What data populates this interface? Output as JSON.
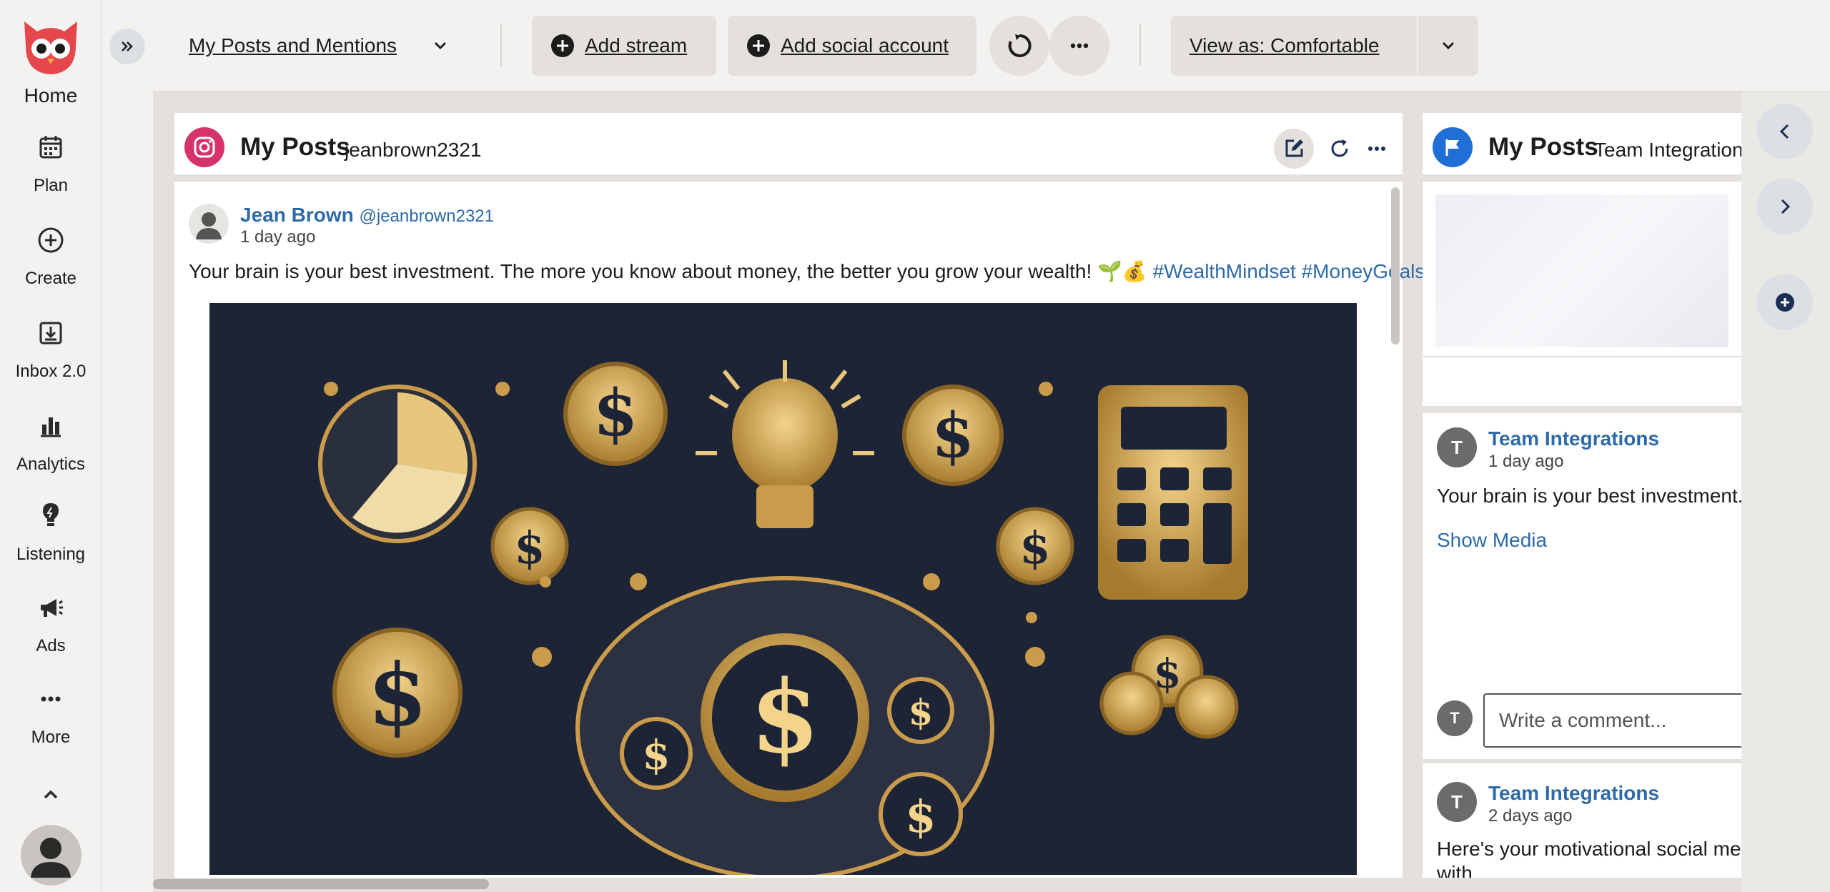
{
  "nav": {
    "home": "Home",
    "items": [
      {
        "label": "Plan",
        "icon": "calendar-icon"
      },
      {
        "label": "Create",
        "icon": "plus-circle-icon"
      },
      {
        "label": "Inbox 2.0",
        "icon": "inbox-icon"
      },
      {
        "label": "Analytics",
        "icon": "bar-chart-icon"
      },
      {
        "label": "Listening",
        "icon": "lightbulb-icon"
      },
      {
        "label": "Ads",
        "icon": "megaphone-icon"
      },
      {
        "label": "More",
        "icon": "more-horizontal-icon"
      }
    ]
  },
  "topbar": {
    "board_select": "My Posts and Mentions",
    "add_stream": "Add stream",
    "add_social_account": "Add social account",
    "view_as": "View as: Comfortable"
  },
  "stream1": {
    "title": "My Posts",
    "account": "jeanbrown2321",
    "network_color": "#d6336c",
    "post": {
      "author": "Jean Brown",
      "handle": "@jeanbrown2321",
      "time": "1 day ago",
      "text": "Your brain is your best investment. The more you know about money, the better you grow your wealth! 🌱💰",
      "hashtag1": "#WealthMindset",
      "hashtag2": "#MoneyGoals"
    }
  },
  "stream2": {
    "title": "My Posts",
    "account": "Team Integrations",
    "network_color": "#1f6fd6",
    "post1": {
      "author": "Team Integrations",
      "time": "1 day ago",
      "text": "Your brain is your best investment. T",
      "show_media": "Show Media",
      "comment_placeholder": "Write a comment..."
    },
    "post2": {
      "author": "Team Integrations",
      "time": "2 days ago",
      "text": "Here's your motivational social med",
      "text2": "with"
    },
    "avatar_letter": "T"
  },
  "colors": {
    "accent_link": "#2e6aa8",
    "logo_red": "#e5474d"
  }
}
